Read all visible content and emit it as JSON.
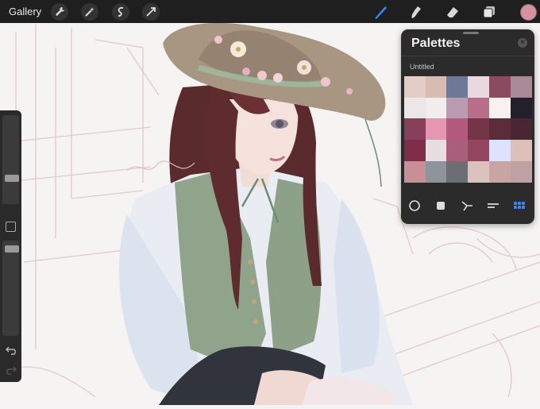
{
  "topbar": {
    "gallery_label": "Gallery",
    "left_tools": [
      {
        "icon": "wrench-icon"
      },
      {
        "icon": "magic-wand-icon"
      },
      {
        "icon": "selection-icon"
      },
      {
        "icon": "transform-arrow-icon"
      }
    ],
    "right_tools": [
      {
        "icon": "brush-icon",
        "active_color": "#3b82f6"
      },
      {
        "icon": "smudge-icon"
      },
      {
        "icon": "eraser-icon"
      },
      {
        "icon": "layers-icon"
      }
    ],
    "current_color": "#d6929f"
  },
  "sidebar": {
    "brush_size_level": 0.27,
    "opacity_level": 0.95,
    "icons": [
      "modify-square-icon",
      "undo-icon",
      "redo-icon"
    ]
  },
  "palettes_panel": {
    "title": "Palettes",
    "palette_name": "Untitled",
    "swatches": [
      [
        "#e3cdc6",
        "#d7bcb1",
        "#6f7894",
        "#ead8df",
        "#8a4a60",
        "#a78a95"
      ],
      [
        "#ece6e8",
        "#f2ecef",
        "#b99ab0",
        "#b86d8a",
        "#f8f1ef",
        "#22202a"
      ],
      [
        "#86405a",
        "#e796b2",
        "#b35a7c",
        "#723648",
        "#5b2d3a",
        "#4a2632"
      ],
      [
        "#7e2e4a",
        "#e8dde1",
        "#a95f79",
        "#94455f",
        "#dfe2ff",
        "#dcbfb6"
      ],
      [
        "#c98f96",
        "#8e939c",
        "#6d6e74",
        "#dcc2bf",
        "#c8a4a2",
        "#bfa0a3"
      ]
    ],
    "view_tabs": [
      "disc-icon",
      "square-icon",
      "harmony-icon",
      "value-icon",
      "palette-grid-icon"
    ],
    "active_tab_color": "#3b82f6"
  }
}
